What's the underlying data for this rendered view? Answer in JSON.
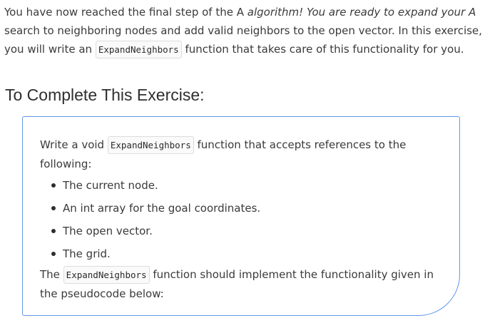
{
  "intro": {
    "part1": "You have now reached the final step of the A ",
    "part2_italic": "algorithm! You are ready to expand your A",
    "part3": " search to neighboring nodes and add valid neighbors to the open vector. In this exercise, you will write an ",
    "code": "ExpandNeighbors",
    "part4": " function that takes care of this functionality for you."
  },
  "heading": "To Complete This Exercise:",
  "box": {
    "line1_a": "Write a void ",
    "line1_code": "ExpandNeighbors",
    "line1_b": " function that accepts references to the following:",
    "bullets": [
      "The current node.",
      "An int array for the goal coordinates.",
      "The open vector.",
      "The grid."
    ],
    "line2_a": "The ",
    "line2_code": "ExpandNeighbors",
    "line2_b": " function should implement the functionality given in the pseudocode below:"
  }
}
